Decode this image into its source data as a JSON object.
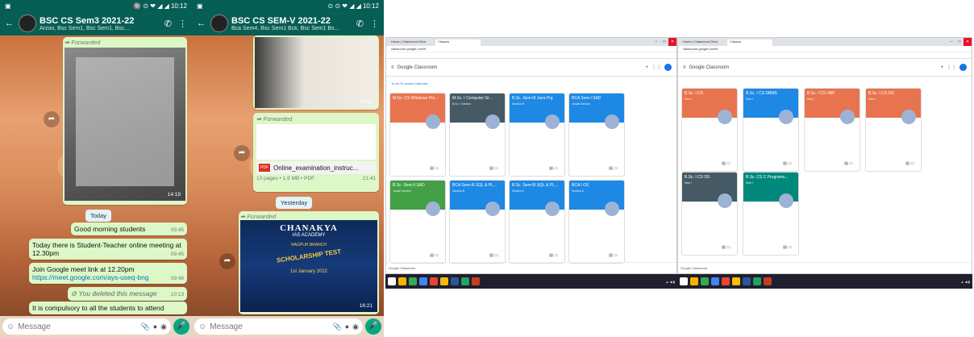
{
  "phone1": {
    "status_left": "▣",
    "status_right": "🔘 ⊙ ❤ ◢ ◢ 10:12",
    "title": "BSC CS Sem3 2021-22",
    "subtitle": "Arzoo, Bsc Sem1, Bsc Sem1, Bsc...",
    "forwarded": "Forwarded",
    "notice_time": "14:19",
    "date_chip": "Today",
    "msg1": "Good morning students",
    "msg1_time": "09:45",
    "msg2": "Today there is Student-Teacher online meeting at 12.30pm",
    "msg2_time": "09:45",
    "msg3": "Join Google meet link at 12.20pm",
    "msg3_link": "https://meet.google.com/ays-useq-bng",
    "msg3_time": "09:48",
    "deleted": "You deleted this message",
    "deleted_time": "10:13",
    "msg4": "It is compulsory to all the students to attend",
    "input_placeholder": "Message"
  },
  "phone2": {
    "status_left": "▣",
    "status_right": "⊙ ⊙ ❤ ◢ ◢ 10:12",
    "title": "BSC CS SEM-V 2021-22",
    "subtitle": "Bca Sem4, Bsc Sem1 Bck, Bsc Sem1 Bs...",
    "photo_time": "13:50",
    "forwarded": "Forwarded",
    "doc_name": "Online_examination_instruc...",
    "doc_meta": "13 pages • 1.9 MB • PDF",
    "doc_time": "21:41",
    "date_chip": "Yesterday",
    "forwarded2": "Forwarded",
    "poster_title": "CHANAKYA",
    "poster_sub": "IAS ACADEMY",
    "poster_branch": "NAGPUR BRANCH",
    "poster_test": "SCHOLARSHIP TEST",
    "poster_date": "1st January 2022",
    "poster_time": "16:21",
    "input_placeholder": "Message"
  },
  "browser1": {
    "tab1": "Home | Classroom Drive",
    "tab2": "Classes",
    "url": "classroom.google.com/h",
    "app": "Google Classroom",
    "todo": "To-do   To review   Calendar",
    "cards": [
      {
        "title": "M.Sc.-CS Windows Pro...",
        "sub": "",
        "color": "#e8744f"
      },
      {
        "title": "M.Sc. I Computer Gr...",
        "sub": "B.Sc. I Section",
        "color": "#455a64"
      },
      {
        "title": "B.Sc. Sem-III Java Prg",
        "sub": "Section B",
        "color": "#1e88e5"
      },
      {
        "title": "BCA Sem-I SAD",
        "sub": "Janaki Section",
        "color": "#1e88e5"
      },
      {
        "title": "B.Sc. Sem-II SAD",
        "sub": "Janaki Section",
        "color": "#43a047"
      },
      {
        "title": "BCA Sem-III SQL & PL...",
        "sub": "Section B",
        "color": "#1e88e5"
      },
      {
        "title": "B.Sc. Sem-III SQL & PL...",
        "sub": "Section A",
        "color": "#1e88e5"
      },
      {
        "title": "BCA I OS",
        "sub": "Section A",
        "color": "#1e88e5"
      }
    ],
    "footer": "Google Classroom"
  },
  "browser2": {
    "tab1": "Home | Classroom Drive",
    "tab2": "Classes",
    "url": "classroom.google.com/h",
    "app": "Google Classroom",
    "cards": [
      {
        "title": "B.Sc. I CS",
        "sub": "Sem I",
        "color": "#e8744f"
      },
      {
        "title": "B.Sc. I CS DBMS",
        "sub": "Sem I",
        "color": "#1e88e5"
      },
      {
        "title": "B.Sc. I CS VBP",
        "sub": "Sem I",
        "color": "#e8744f"
      },
      {
        "title": "B.Sc. I CS OS",
        "sub": "Sem I",
        "color": "#e8744f"
      },
      {
        "title": "B.Sc. I CS DS",
        "sub": "Sem I",
        "color": "#455a64"
      },
      {
        "title": "B.Sc. CS C Programs...",
        "sub": "Sem I",
        "color": "#00897b"
      }
    ],
    "footer": "Google Classroom"
  },
  "colors": {
    "wa_green": "#075e54",
    "bubble": "#dcf8c6",
    "accent": "#00a884"
  }
}
